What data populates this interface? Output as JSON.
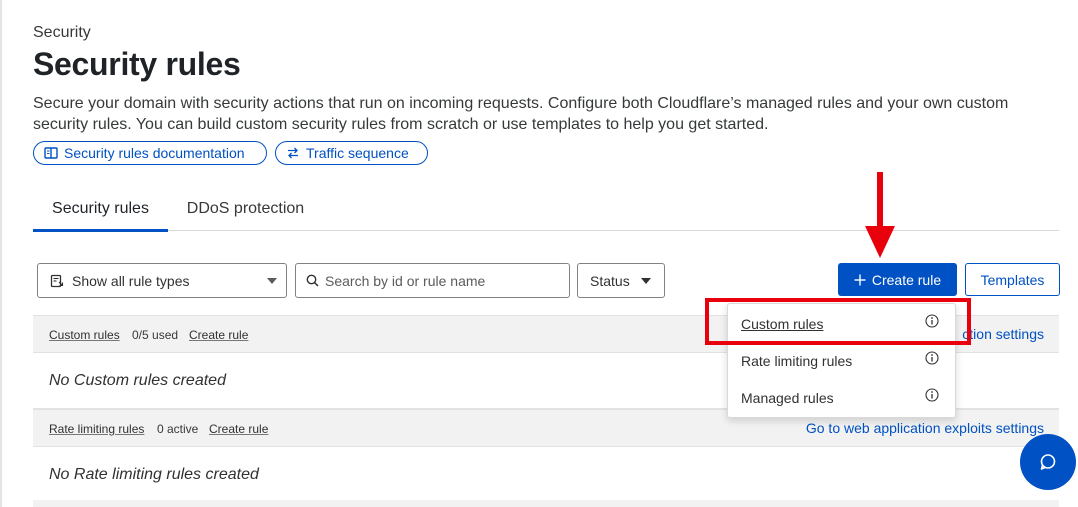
{
  "page": {
    "eyebrow": "Security",
    "title": "Security rules",
    "description": "Secure your domain with security actions that run on incoming requests. Configure both Cloudflare’s managed rules and your own custom security rules. You can build custom security rules from scratch or use templates to help you get started.",
    "doc_link_label": "Security rules documentation",
    "traffic_link_label": "Traffic sequence"
  },
  "tabs": [
    {
      "label": "Security rules",
      "active": true
    },
    {
      "label": "DDoS protection",
      "active": false
    }
  ],
  "filters": {
    "rule_type_value": "Show all rule types",
    "search_placeholder": "Search by id or rule name",
    "status_label": "Status"
  },
  "toolbar": {
    "create_label": "Create rule",
    "templates_label": "Templates"
  },
  "sections": [
    {
      "name": "Custom rules",
      "count": "0/5 used",
      "create_label": "Create rule",
      "right_link": "Go to web application protection settings",
      "right_link_visible": "ction settings",
      "empty": "No Custom rules created"
    },
    {
      "name": "Rate limiting rules",
      "count": "0 active",
      "create_label": "Create rule",
      "right_link": "Go to web application exploits settings",
      "empty": "No Rate limiting rules created"
    }
  ],
  "dropdown": {
    "items": [
      "Custom rules",
      "Rate limiting rules",
      "Managed rules"
    ]
  },
  "colors": {
    "accent": "#0051c3",
    "annotation_red": "#e8000d"
  },
  "icons": [
    "book-icon",
    "swap-icon",
    "rule-type-icon",
    "search-icon",
    "caret-down-icon",
    "plus-icon",
    "info-icon",
    "chat-icon",
    "arrow-down-icon"
  ]
}
